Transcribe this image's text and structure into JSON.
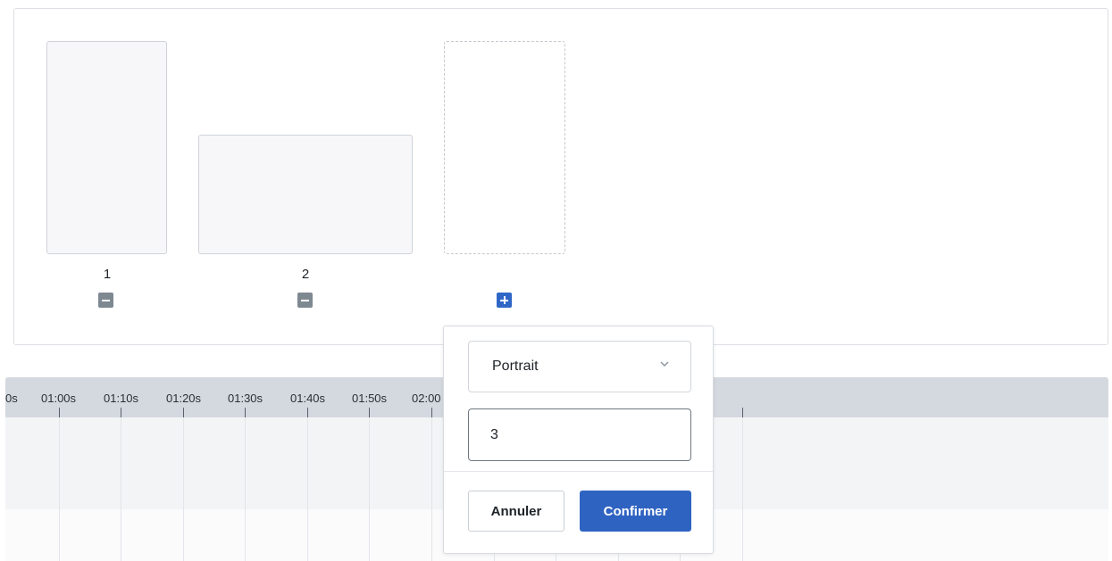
{
  "frames": [
    {
      "label": "1",
      "remove_icon": "minus-icon"
    },
    {
      "label": "2",
      "remove_icon": "minus-icon"
    }
  ],
  "new_frame": {
    "add_icon": "plus-icon"
  },
  "timeline": {
    "ticks": [
      "0s",
      "01:00s",
      "01:10s",
      "01:20s",
      "01:30s",
      "01:40s",
      "01:50s",
      "02:00"
    ]
  },
  "popover": {
    "orientation_selected": "Portrait",
    "count_value": "3",
    "cancel_label": "Annuler",
    "confirm_label": "Confirmer"
  },
  "colors": {
    "accent": "#2f63c2",
    "remove_button": "#7e8891",
    "timeline_header": "#d4d9df"
  }
}
